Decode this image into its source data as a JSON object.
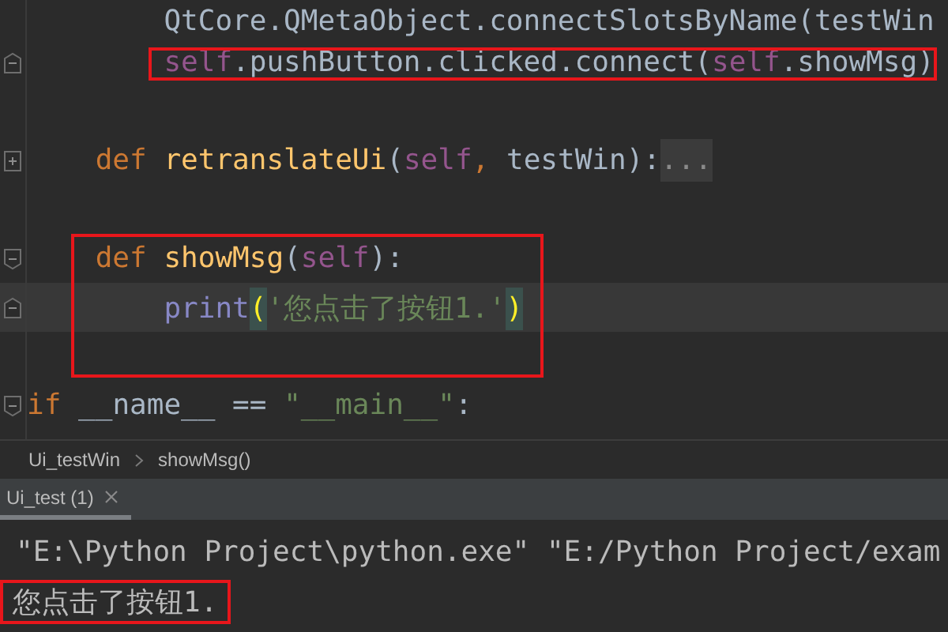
{
  "editor": {
    "blocks": [
      {
        "annotated": false,
        "lines": [
          {
            "kind": "body",
            "fold_start": false,
            "fold_end": false,
            "collapsed": false,
            "current": false,
            "tokens": [
              {
                "kind": "plain",
                "text": "QtCore.QMetaObject.connectSlotsByName(testWin"
              }
            ]
          }
        ]
      },
      {
        "annotated": true,
        "lines": [
          {
            "kind": "body",
            "fold_start": false,
            "fold_end": true,
            "collapsed": false,
            "current": false,
            "tokens": [
              {
                "kind": "self",
                "text": "self"
              },
              {
                "kind": "plain",
                "text": ".pushButton.clicked.connect("
              },
              {
                "kind": "self",
                "text": "self"
              },
              {
                "kind": "plain",
                "text": ".showMsg)"
              }
            ]
          }
        ]
      },
      {
        "annotated": false,
        "lines": [
          {
            "kind": "blank",
            "fold_start": false,
            "fold_end": false,
            "collapsed": false,
            "current": false
          },
          {
            "kind": "member",
            "fold_start": false,
            "fold_end": false,
            "collapsed": true,
            "current": false,
            "tokens": [
              {
                "kind": "keyword",
                "text": "def "
              },
              {
                "kind": "funcname",
                "text": "retranslateUi"
              },
              {
                "kind": "plain",
                "text": "("
              },
              {
                "kind": "self",
                "text": "self"
              },
              {
                "kind": "keyword",
                "text": ", "
              },
              {
                "kind": "plain",
                "text": "testWin):"
              },
              {
                "kind": "folded",
                "text": "..."
              }
            ]
          },
          {
            "kind": "blank",
            "fold_start": false,
            "fold_end": false,
            "collapsed": false,
            "current": false
          }
        ]
      },
      {
        "annotated": true,
        "lines": [
          {
            "kind": "member",
            "fold_start": true,
            "fold_end": false,
            "collapsed": false,
            "current": false,
            "tokens": [
              {
                "kind": "keyword",
                "text": "def "
              },
              {
                "kind": "funcname",
                "text": "showMsg"
              },
              {
                "kind": "plain",
                "text": "("
              },
              {
                "kind": "self",
                "text": "self"
              },
              {
                "kind": "plain",
                "text": "):"
              }
            ]
          },
          {
            "kind": "body",
            "fold_start": false,
            "fold_end": true,
            "collapsed": false,
            "current": true,
            "tokens": [
              {
                "kind": "builtin",
                "text": "print"
              },
              {
                "kind": "bracket",
                "text": "("
              },
              {
                "kind": "string",
                "text": "'您点击了按钮1.'"
              },
              {
                "kind": "bracket",
                "text": ")"
              }
            ]
          },
          {
            "kind": "blank",
            "fold_start": false,
            "fold_end": false,
            "collapsed": false,
            "current": false
          }
        ]
      },
      {
        "annotated": false,
        "lines": [
          {
            "kind": "module",
            "fold_start": true,
            "fold_end": false,
            "collapsed": false,
            "current": false,
            "tokens": [
              {
                "kind": "keyword",
                "text": "if "
              },
              {
                "kind": "plain",
                "text": "__name__ == "
              },
              {
                "kind": "string",
                "text": "\"__main__\""
              },
              {
                "kind": "plain",
                "text": ":"
              }
            ]
          }
        ]
      }
    ]
  },
  "breadcrumb": [
    "Ui_testWin",
    "showMsg()"
  ],
  "run_tabs": [
    {
      "label": "Ui_test (1)",
      "selected": true
    }
  ],
  "console": {
    "lines": [
      {
        "text": "\"E:\\Python Project\\python.exe\" \"E:/Python Project/exam",
        "annotated": false
      },
      {
        "text": "您点击了按钮1.",
        "annotated": true
      }
    ]
  }
}
